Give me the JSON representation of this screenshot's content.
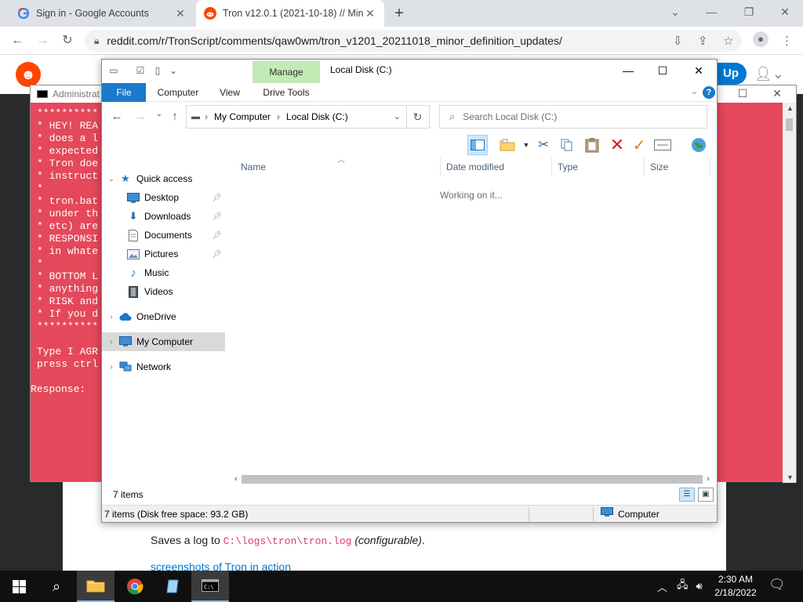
{
  "browser": {
    "tabs": [
      {
        "title": "Sign in - Google Accounts",
        "favicon": "google-icon"
      },
      {
        "title": "Tron v12.0.1 (2021-10-18) // Min",
        "favicon": "reddit-icon"
      }
    ],
    "new_tab": "+",
    "url": "reddit.com/r/TronScript/comments/qaw0wm/tron_v1201_20211018_minor_definition_updates/"
  },
  "reddit": {
    "logo": "reddit-logo",
    "signup_label": "Up",
    "post_log_prefix": "Saves a log to ",
    "post_log_path": "C:\\logs\\tron\\tron.log",
    "post_log_suffix": "(configurable)",
    "post_log_end": ".",
    "screenshots_link": "screenshots of Tron in action"
  },
  "cmd": {
    "title": "Administrat",
    "lines": [
      "**********",
      "* HEY! REA",
      "* does a l",
      "* expected",
      "* Tron doe",
      "* instruct",
      "*",
      "* tron.bat",
      "* under th",
      "* etc) are",
      "* RESPONSI",
      "* in whate",
      "*",
      "* BOTTOM L",
      "* anything",
      "* RISK and",
      "* If you d",
      "**********",
      "",
      "Type I AGR",
      "press ctrl",
      "",
      "Response:"
    ],
    "bg_color": "#e5485a"
  },
  "explorer": {
    "manage_label": "Manage",
    "window_title": "Local Disk (C:)",
    "ribbon_tabs": [
      "File",
      "Computer",
      "View",
      "Drive Tools"
    ],
    "breadcrumbs": [
      "My Computer",
      "Local Disk (C:)"
    ],
    "search_placeholder": "Search Local Disk (C:)",
    "columns": [
      "Name",
      "Date modified",
      "Type",
      "Size"
    ],
    "working_text": "Working on it...",
    "nav": {
      "quick_access": "Quick access",
      "quick_items": [
        {
          "label": "Desktop",
          "pinned": true
        },
        {
          "label": "Downloads",
          "pinned": true
        },
        {
          "label": "Documents",
          "pinned": true
        },
        {
          "label": "Pictures",
          "pinned": true
        },
        {
          "label": "Music",
          "pinned": false
        },
        {
          "label": "Videos",
          "pinned": false
        }
      ],
      "onedrive": "OneDrive",
      "my_computer": "My Computer",
      "network": "Network"
    },
    "status_items": "7 items",
    "status_detail": "7 items (Disk free space: 93.2 GB)",
    "status_location": "Computer",
    "accent": "#1979ca",
    "manage_color": "#c3eab4"
  },
  "taskbar": {
    "time": "2:30 AM",
    "date": "2/18/2022"
  }
}
